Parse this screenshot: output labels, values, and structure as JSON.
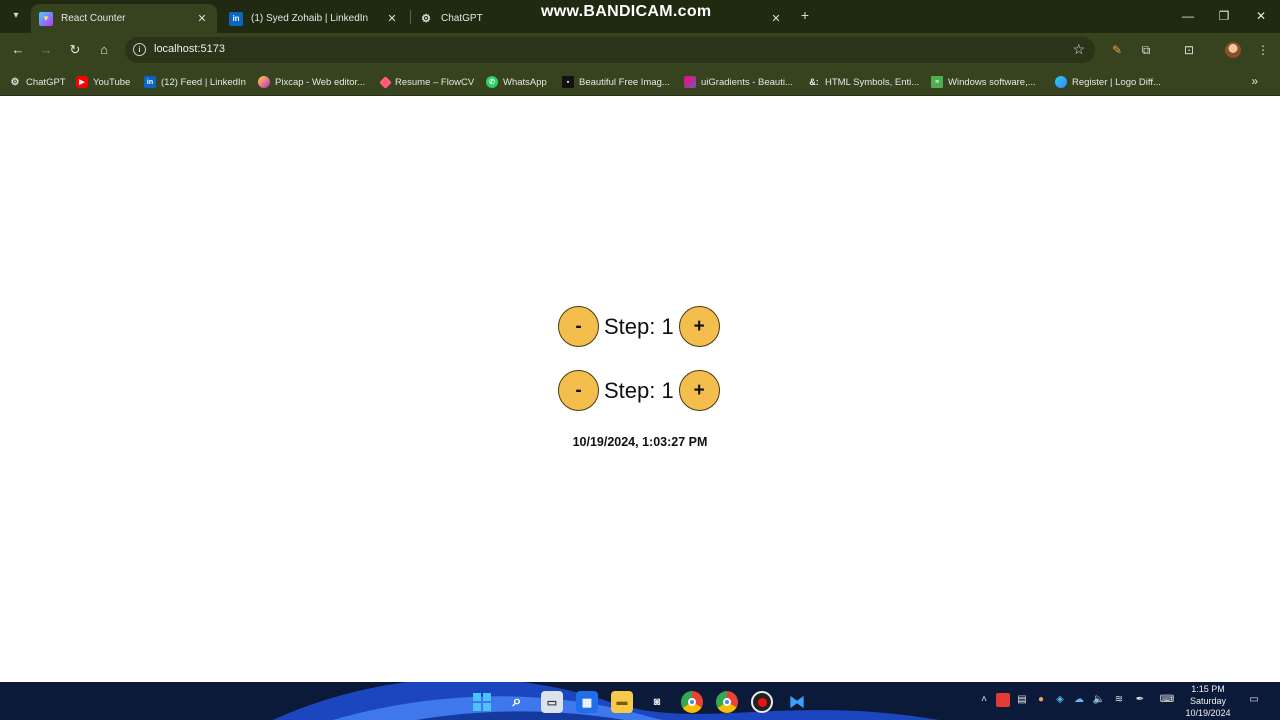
{
  "browser": {
    "tabs": [
      {
        "title": "React Counter",
        "icon": "vite-icon",
        "active": true
      },
      {
        "title": "(1) Syed Zohaib | LinkedIn",
        "icon": "linkedin-icon",
        "active": false
      },
      {
        "title": "ChatGPT",
        "icon": "chatgpt-icon",
        "active": false
      }
    ],
    "watermark": "www.BANDICAM.com",
    "address": {
      "url": "localhost:5173"
    },
    "bookmarks": [
      {
        "label": "ChatGPT",
        "icon": "chatgpt-icon"
      },
      {
        "label": "YouTube",
        "icon": "youtube-icon"
      },
      {
        "label": "(12) Feed | LinkedIn",
        "icon": "linkedin-icon"
      },
      {
        "label": "Pixcap - Web editor...",
        "icon": "pixcap-icon"
      },
      {
        "label": "Resume – FlowCV",
        "icon": "flowcv-icon"
      },
      {
        "label": "WhatsApp",
        "icon": "whatsapp-icon"
      },
      {
        "label": "Beautiful Free Imag...",
        "icon": "unsplash-icon"
      },
      {
        "label": "uiGradients - Beauti...",
        "icon": "uigradients-icon"
      },
      {
        "label": "HTML Symbols, Enti...",
        "icon": "html-symbols-icon"
      },
      {
        "label": "Windows software,...",
        "icon": "windows-software-icon"
      },
      {
        "label": "Register | Logo Diff...",
        "icon": "logo-diffusion-icon"
      }
    ]
  },
  "counter": {
    "rows": [
      {
        "minus_label": "-",
        "step_label": "Step: 1",
        "plus_label": "+"
      },
      {
        "minus_label": "-",
        "step_label": "Step: 1",
        "plus_label": "+"
      }
    ],
    "date_text": "10/19/2024, 1:03:27 PM"
  },
  "taskbar": {
    "time": "1:15 PM",
    "day": "Saturday",
    "date": "10/19/2024"
  },
  "colors": {
    "button_fill": "#f4be4f",
    "chrome_dark": "#1f2a10",
    "chrome_toolbar": "#37421f",
    "taskbar": "#0c1a3a"
  }
}
